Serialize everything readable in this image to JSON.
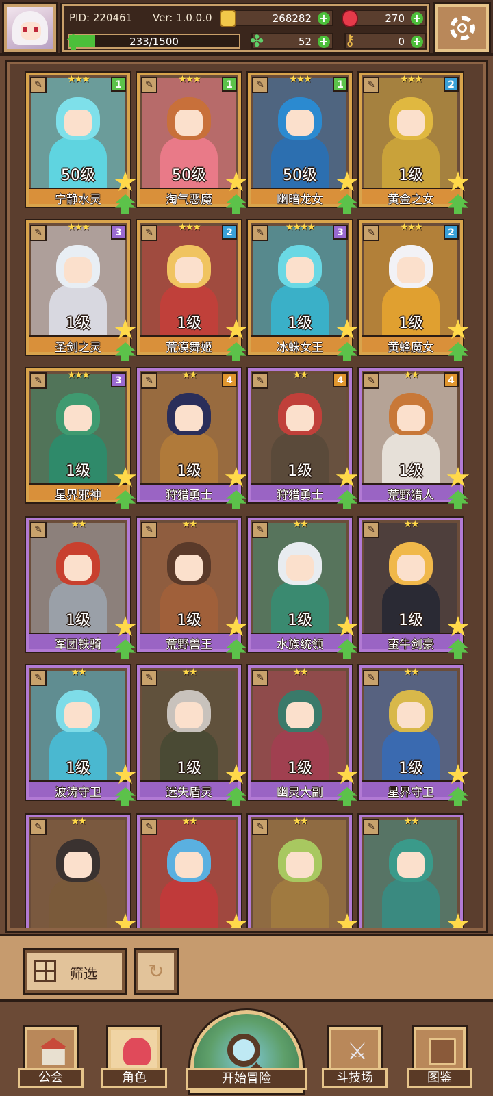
{
  "header": {
    "pid": "PID: 220461",
    "version": "Ver: 1.0.0.0",
    "gold": "268282",
    "gems": "270",
    "stamina": "233/1500",
    "stamina_fill": 0.155,
    "clover": "52",
    "keys": "0",
    "settings_icon": "gear-icon",
    "colors": {
      "accent": "#c9a06a",
      "plus": "#4cbf3a",
      "gold": "#f2c84a",
      "gem": "#e63a4a"
    }
  },
  "cards": [
    {
      "name": "宁静水灵",
      "level": "50级",
      "rank": "1",
      "stars": "★★★",
      "frame": "gold",
      "color": "#5fd4e0",
      "hair": "#7ee0ea"
    },
    {
      "name": "淘气恶魔",
      "level": "50级",
      "rank": "1",
      "stars": "★★★",
      "frame": "gold",
      "color": "#e97a88",
      "hair": "#c8703a"
    },
    {
      "name": "幽暗龙女",
      "level": "50级",
      "rank": "1",
      "stars": "★★★",
      "frame": "gold",
      "color": "#2c6fb0",
      "hair": "#2b8ad0"
    },
    {
      "name": "黄金之女",
      "level": "1级",
      "rank": "2",
      "stars": "★★★",
      "frame": "gold",
      "color": "#c9a23a",
      "hair": "#e0b840"
    },
    {
      "name": "圣剑之灵",
      "level": "1级",
      "rank": "3",
      "stars": "★★★",
      "frame": "gold",
      "color": "#d8d8e0",
      "hair": "#e8eef4"
    },
    {
      "name": "荒漠舞姬",
      "level": "1级",
      "rank": "2",
      "stars": "★★★",
      "frame": "gold",
      "color": "#c0403a",
      "hair": "#f0c460"
    },
    {
      "name": "冰蛛女王",
      "level": "1级",
      "rank": "3",
      "stars": "★★★★",
      "frame": "gold",
      "color": "#3ab0c8",
      "hair": "#6ad8e4"
    },
    {
      "name": "黄蜂魔女",
      "level": "1级",
      "rank": "2",
      "stars": "★★★",
      "frame": "gold",
      "color": "#e0a030",
      "hair": "#f2f2f6"
    },
    {
      "name": "星界邪神",
      "level": "1级",
      "rank": "3",
      "stars": "★★★",
      "frame": "gold",
      "color": "#2f8a6a",
      "hair": "#3f9a70"
    },
    {
      "name": "狩猎勇士",
      "level": "1级",
      "rank": "4",
      "stars": "★★",
      "frame": "purple",
      "color": "#b07a3a",
      "hair": "#2a2e5a"
    },
    {
      "name": "狩猎勇士",
      "level": "1级",
      "rank": "4",
      "stars": "★★",
      "frame": "purple",
      "color": "#5a4a3a",
      "hair": "#c0403a"
    },
    {
      "name": "荒野猎人",
      "level": "1级",
      "rank": "4",
      "stars": "★★",
      "frame": "purple",
      "color": "#e6e0d8",
      "hair": "#c87838"
    },
    {
      "name": "军团铁骑",
      "level": "1级",
      "rank": "",
      "stars": "★★",
      "frame": "purple",
      "color": "#9aa0a8",
      "hair": "#c8402e"
    },
    {
      "name": "荒野兽王",
      "level": "1级",
      "rank": "",
      "stars": "★★",
      "frame": "purple",
      "color": "#a0603a",
      "hair": "#5a3a2a"
    },
    {
      "name": "水族统领",
      "level": "1级",
      "rank": "",
      "stars": "★★",
      "frame": "purple",
      "color": "#3a8a70",
      "hair": "#e8ecf0"
    },
    {
      "name": "蛮牛剑豪",
      "level": "1级",
      "rank": "",
      "stars": "★★",
      "frame": "purple",
      "color": "#2a2a34",
      "hair": "#f0b84a"
    },
    {
      "name": "波涛守卫",
      "level": "1级",
      "rank": "",
      "stars": "★★",
      "frame": "purple",
      "color": "#4ab8d0",
      "hair": "#7edce8"
    },
    {
      "name": "迷失盾灵",
      "level": "1级",
      "rank": "",
      "stars": "★★",
      "frame": "purple",
      "color": "#4a4a34",
      "hair": "#c8c2bc"
    },
    {
      "name": "幽灵大副",
      "level": "1级",
      "rank": "",
      "stars": "★★",
      "frame": "purple",
      "color": "#a04050",
      "hair": "#3a7a6a"
    },
    {
      "name": "星界守卫",
      "level": "1级",
      "rank": "",
      "stars": "★★",
      "frame": "purple",
      "color": "#3a6ab0",
      "hair": "#d8b84a"
    },
    {
      "name": "",
      "level": "",
      "rank": "",
      "stars": "★★",
      "frame": "purple",
      "color": "#7a5a3a",
      "hair": "#3a3230"
    },
    {
      "name": "",
      "level": "",
      "rank": "",
      "stars": "★★",
      "frame": "purple",
      "color": "#c03a3a",
      "hair": "#5ab0e0"
    },
    {
      "name": "",
      "level": "",
      "rank": "",
      "stars": "★★",
      "frame": "purple",
      "color": "#a07a40",
      "hair": "#a8c860"
    },
    {
      "name": "",
      "level": "",
      "rank": "",
      "stars": "★★",
      "frame": "purple",
      "color": "#3a8a80",
      "hair": "#3a9a8a"
    }
  ],
  "controls": {
    "filter_label": "筛选",
    "filter_icon": "grid-icon",
    "reset_icon": "refresh-icon"
  },
  "nav": {
    "guild": "公会",
    "character": "角色",
    "adventure": "开始冒险",
    "arena": "斗技场",
    "codex": "图鉴",
    "active": "character"
  }
}
